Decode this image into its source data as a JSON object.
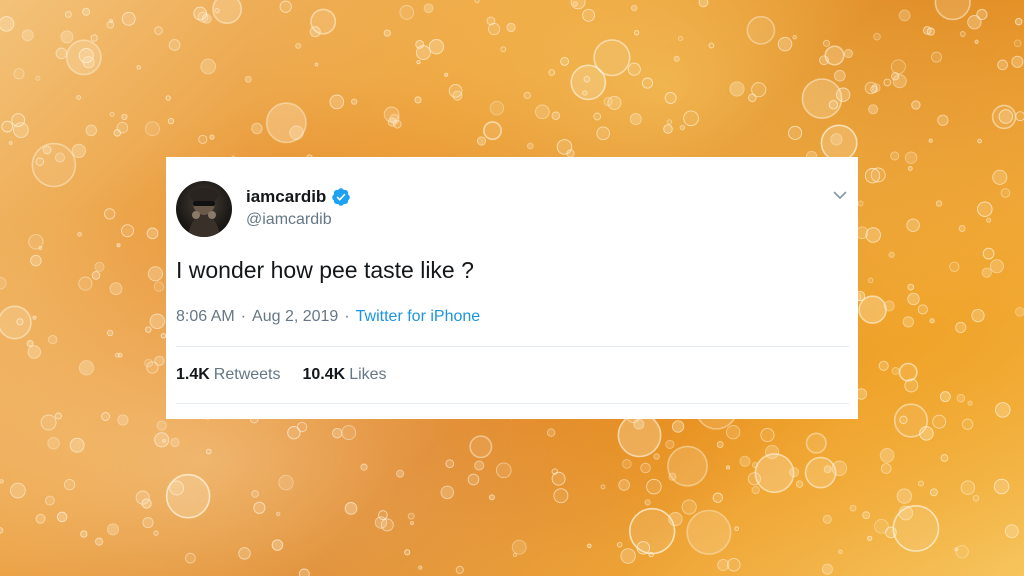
{
  "tweet": {
    "display_name": "iamcardib",
    "handle": "@iamcardib",
    "verified": true,
    "text": "I wonder how pee taste like ?",
    "time": "8:06 AM",
    "date": "Aug 2, 2019",
    "separator": "·",
    "source": "Twitter for iPhone",
    "retweets_count": "1.4K",
    "retweets_label": "Retweets",
    "likes_count": "10.4K",
    "likes_label": "Likes"
  },
  "icons": {
    "verified": "verified-badge-icon",
    "menu": "chevron-down-icon"
  },
  "colors": {
    "background": "#e9962f",
    "card": "#ffffff",
    "text_primary": "#14171a",
    "text_secondary": "#657786",
    "link": "#1b95e0",
    "verified": "#1da1f2"
  }
}
